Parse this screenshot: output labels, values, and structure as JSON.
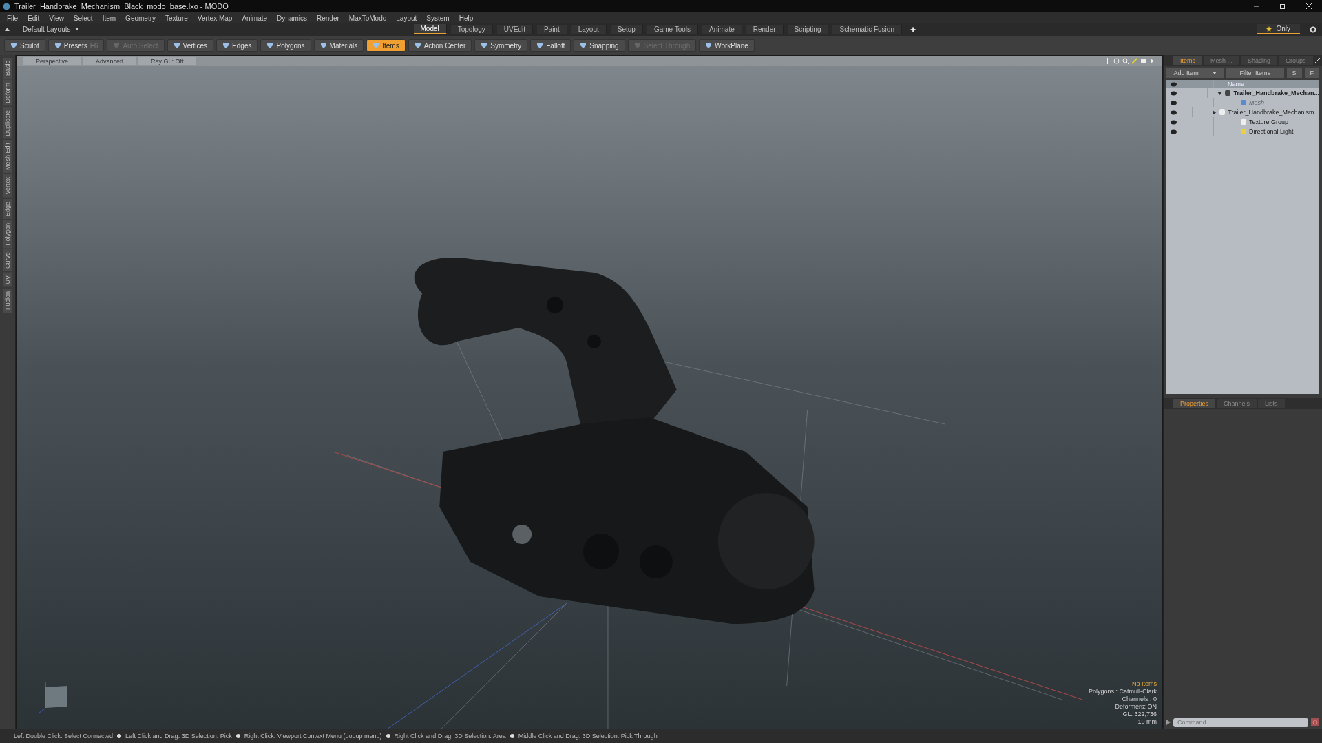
{
  "window": {
    "title": "Trailer_Handbrake_Mechanism_Black_modo_base.lxo - MODO"
  },
  "menu": [
    "File",
    "Edit",
    "View",
    "Select",
    "Item",
    "Geometry",
    "Texture",
    "Vertex Map",
    "Animate",
    "Dynamics",
    "Render",
    "MaxToModo",
    "Layout",
    "System",
    "Help"
  ],
  "layouts_menu": "Default Layouts",
  "layout_tabs": [
    {
      "label": "Model",
      "selected": true
    },
    {
      "label": "Topology",
      "selected": false
    },
    {
      "label": "UVEdit",
      "selected": false
    },
    {
      "label": "Paint",
      "selected": false
    },
    {
      "label": "Layout",
      "selected": false
    },
    {
      "label": "Setup",
      "selected": false
    },
    {
      "label": "Game Tools",
      "selected": false
    },
    {
      "label": "Animate",
      "selected": false
    },
    {
      "label": "Render",
      "selected": false
    },
    {
      "label": "Scripting",
      "selected": false
    },
    {
      "label": "Schematic Fusion",
      "selected": false
    }
  ],
  "add_tab": "+",
  "only_button": "Only",
  "toolbar": [
    {
      "label": "Sculpt",
      "selected": false,
      "disabled": false
    },
    {
      "label": "Presets",
      "shortcut": "F6",
      "selected": false,
      "disabled": false
    },
    {
      "label": "Auto Select",
      "selected": false,
      "disabled": true
    },
    {
      "label": "Vertices",
      "selected": false,
      "disabled": false
    },
    {
      "label": "Edges",
      "selected": false,
      "disabled": false
    },
    {
      "label": "Polygons",
      "selected": false,
      "disabled": false
    },
    {
      "label": "Materials",
      "selected": false,
      "disabled": false
    },
    {
      "label": "Items",
      "selected": true,
      "disabled": false
    },
    {
      "label": "Action Center",
      "selected": false,
      "disabled": false
    },
    {
      "label": "Symmetry",
      "selected": false,
      "disabled": false
    },
    {
      "label": "Falloff",
      "selected": false,
      "disabled": false
    },
    {
      "label": "Snapping",
      "selected": false,
      "disabled": false
    },
    {
      "label": "Select Through",
      "selected": false,
      "disabled": true
    },
    {
      "label": "WorkPlane",
      "selected": false,
      "disabled": false
    }
  ],
  "left_tabs": [
    "Basic",
    "Deform",
    "Duplicate",
    "Mesh Edit",
    "Vertex",
    "Edge",
    "Polygon",
    "Curve",
    "UV",
    "Fusion"
  ],
  "viewport": {
    "header": [
      "Perspective",
      "Advanced",
      "Ray GL: Off"
    ],
    "info": [
      {
        "text": "No Items",
        "kind": "highlight"
      },
      {
        "text": "Polygons : Catmull-Clark",
        "kind": "plain"
      },
      {
        "text": "Channels : 0",
        "kind": "plain"
      },
      {
        "text": "Deformers: ON",
        "kind": "plain"
      },
      {
        "text": "GL: 322,736",
        "kind": "plain"
      },
      {
        "text": "10 mm",
        "kind": "plain"
      }
    ]
  },
  "items_panel": {
    "tabs": [
      {
        "label": "Items",
        "selected": true
      },
      {
        "label": "Mesh ...",
        "selected": false
      },
      {
        "label": "Shading",
        "selected": false
      },
      {
        "label": "Groups",
        "selected": false
      }
    ],
    "add_item": "Add Item",
    "filter": "Filter Items",
    "buttons": [
      "S",
      "F"
    ],
    "column": "Name",
    "tree": [
      {
        "label": "Trailer_Handbrake_Mechan...",
        "kind": "scene",
        "disabled": false,
        "expanded": true,
        "children": [
          {
            "label": "Mesh",
            "kind": "mesh",
            "disabled": true
          },
          {
            "label": "Trailer_Handbrake_Mechanism...",
            "kind": "group",
            "disabled": false,
            "expanded": false
          },
          {
            "label": "Texture Group",
            "kind": "group",
            "disabled": false
          },
          {
            "label": "Directional Light",
            "kind": "light",
            "disabled": false
          }
        ]
      }
    ]
  },
  "properties_panel": {
    "tabs": [
      {
        "label": "Properties",
        "selected": true
      },
      {
        "label": "Channels",
        "selected": false
      },
      {
        "label": "Lists",
        "selected": false
      }
    ]
  },
  "command": {
    "placeholder": "Command"
  },
  "status_bar": [
    "Left Double Click: Select Connected",
    "Left Click and Drag: 3D Selection: Pick",
    "Right Click: Viewport Context Menu (popup menu)",
    "Right Click and Drag: 3D Selection: Area",
    "Middle Click and Drag: 3D Selection: Pick Through"
  ]
}
